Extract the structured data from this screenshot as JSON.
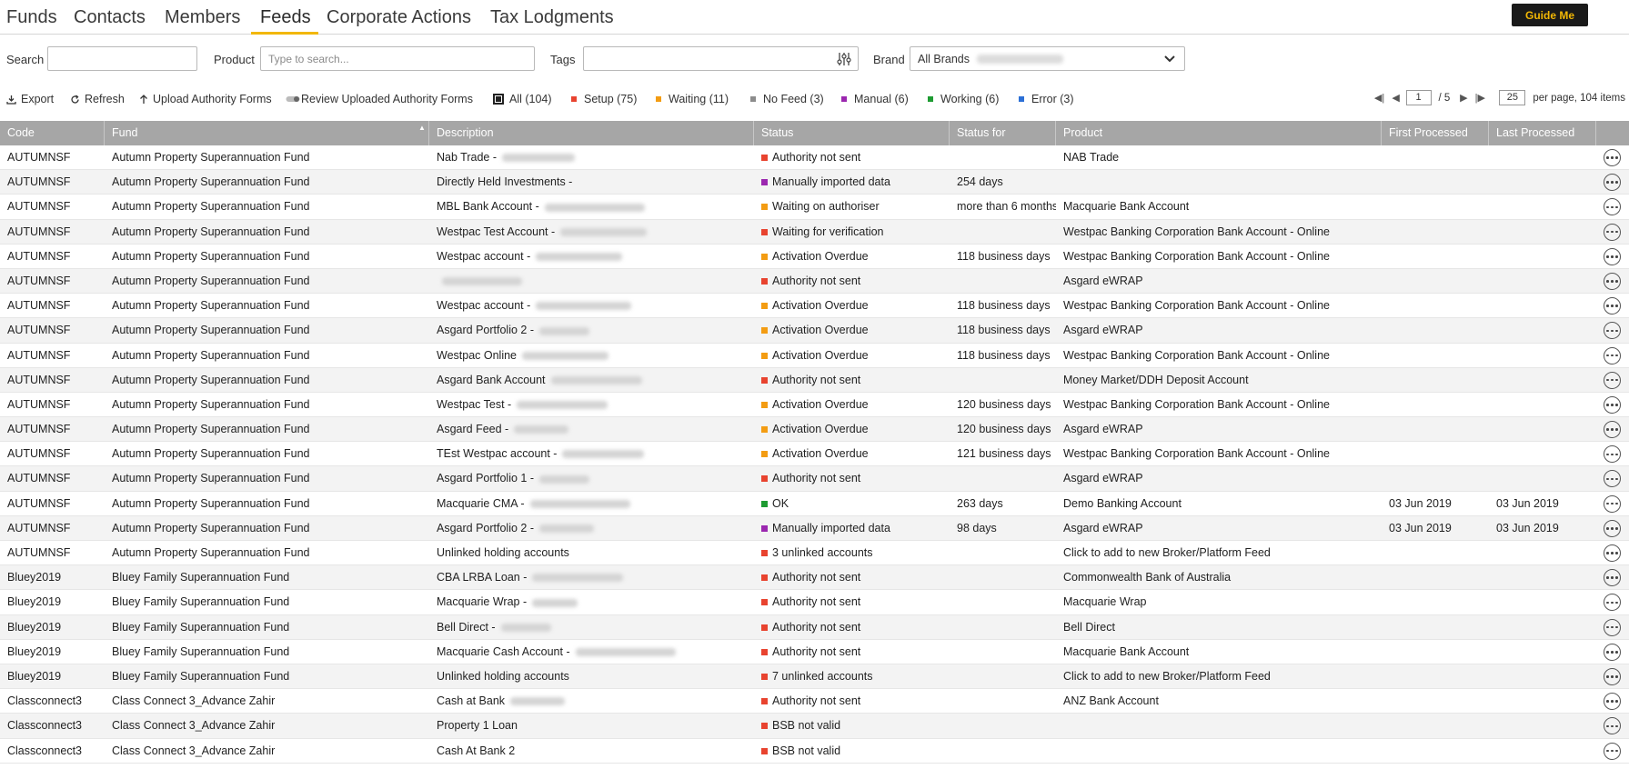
{
  "nav": {
    "tabs": [
      {
        "label": "Funds"
      },
      {
        "label": "Contacts"
      },
      {
        "label": "Members"
      },
      {
        "label": "Feeds"
      },
      {
        "label": "Corporate Actions"
      },
      {
        "label": "Tax Lodgments"
      }
    ],
    "active_tab": "Feeds",
    "guide_button": "Guide Me"
  },
  "filters": {
    "search_label": "Search",
    "search_value": "",
    "product_label": "Product",
    "product_placeholder": "Type to search...",
    "tags_label": "Tags",
    "tags_value": "",
    "brand_label": "Brand",
    "brand_value": "All Brands"
  },
  "toolbar": {
    "export": "Export",
    "refresh": "Refresh",
    "upload": "Upload Authority Forms",
    "review": "Review Uploaded Authority Forms"
  },
  "legend": [
    {
      "label": "All (104)",
      "color": "#222222"
    },
    {
      "label": "Setup (75)",
      "color": "#e8432f"
    },
    {
      "label": "Waiting (11)",
      "color": "#f39c12"
    },
    {
      "label": "No Feed (3)",
      "color": "#8c8c8c"
    },
    {
      "label": "Manual (6)",
      "color": "#9b27af"
    },
    {
      "label": "Working (6)",
      "color": "#1e9b32"
    },
    {
      "label": "Error (3)",
      "color": "#2b6fd6"
    }
  ],
  "pagination": {
    "current_page": "1",
    "total_pages": "/ 5",
    "page_size": "25",
    "summary": "per page, 104 items"
  },
  "columns": [
    "Code",
    "Fund",
    "Description",
    "Status",
    "Status for",
    "Product",
    "First Processed",
    "Last Processed"
  ],
  "status_colors": {
    "red": "#e8432f",
    "orange": "#f39c12",
    "purple": "#9b27af",
    "green": "#1e9b32"
  },
  "rows": [
    {
      "code": "AUTUMNSF",
      "fund": "Autumn Property Superannuation Fund",
      "description": "Nab Trade -",
      "status": "Authority not sent",
      "status_color": "red",
      "status_for": "",
      "product": "NAB Trade",
      "first": "",
      "last": ""
    },
    {
      "code": "AUTUMNSF",
      "fund": "Autumn Property Superannuation Fund",
      "description": "Directly Held Investments -",
      "status": "Manually imported data",
      "status_color": "purple",
      "status_for": "254 days",
      "product": "",
      "first": "",
      "last": ""
    },
    {
      "code": "AUTUMNSF",
      "fund": "Autumn Property Superannuation Fund",
      "description": "MBL Bank Account -",
      "status": "Waiting on authoriser",
      "status_color": "orange",
      "status_for": "more than 6 months",
      "product": "Macquarie Bank Account",
      "first": "",
      "last": ""
    },
    {
      "code": "AUTUMNSF",
      "fund": "Autumn Property Superannuation Fund",
      "description": "Westpac Test Account -",
      "status": "Waiting for verification",
      "status_color": "red",
      "status_for": "",
      "product": "Westpac Banking Corporation Bank Account - Online",
      "first": "",
      "last": ""
    },
    {
      "code": "AUTUMNSF",
      "fund": "Autumn Property Superannuation Fund",
      "description": "Westpac account -",
      "status": "Activation Overdue",
      "status_color": "orange",
      "status_for": "118 business days",
      "product": "Westpac Banking Corporation Bank Account - Online",
      "first": "",
      "last": ""
    },
    {
      "code": "AUTUMNSF",
      "fund": "Autumn Property Superannuation Fund",
      "description": "",
      "status": "Authority not sent",
      "status_color": "red",
      "status_for": "",
      "product": "Asgard eWRAP",
      "first": "",
      "last": ""
    },
    {
      "code": "AUTUMNSF",
      "fund": "Autumn Property Superannuation Fund",
      "description": "Westpac account -",
      "status": "Activation Overdue",
      "status_color": "orange",
      "status_for": "118 business days",
      "product": "Westpac Banking Corporation Bank Account - Online",
      "first": "",
      "last": ""
    },
    {
      "code": "AUTUMNSF",
      "fund": "Autumn Property Superannuation Fund",
      "description": "Asgard Portfolio 2 -",
      "status": "Activation Overdue",
      "status_color": "orange",
      "status_for": "118 business days",
      "product": "Asgard eWRAP",
      "first": "",
      "last": ""
    },
    {
      "code": "AUTUMNSF",
      "fund": "Autumn Property Superannuation Fund",
      "description": "Westpac Online",
      "status": "Activation Overdue",
      "status_color": "orange",
      "status_for": "118 business days",
      "product": "Westpac Banking Corporation Bank Account - Online",
      "first": "",
      "last": ""
    },
    {
      "code": "AUTUMNSF",
      "fund": "Autumn Property Superannuation Fund",
      "description": "Asgard Bank Account",
      "status": "Authority not sent",
      "status_color": "red",
      "status_for": "",
      "product": "Money Market/DDH Deposit Account",
      "first": "",
      "last": ""
    },
    {
      "code": "AUTUMNSF",
      "fund": "Autumn Property Superannuation Fund",
      "description": "Westpac Test -",
      "status": "Activation Overdue",
      "status_color": "orange",
      "status_for": "120 business days",
      "product": "Westpac Banking Corporation Bank Account - Online",
      "first": "",
      "last": ""
    },
    {
      "code": "AUTUMNSF",
      "fund": "Autumn Property Superannuation Fund",
      "description": "Asgard Feed -",
      "status": "Activation Overdue",
      "status_color": "orange",
      "status_for": "120 business days",
      "product": "Asgard eWRAP",
      "first": "",
      "last": ""
    },
    {
      "code": "AUTUMNSF",
      "fund": "Autumn Property Superannuation Fund",
      "description": "TEst Westpac account -",
      "status": "Activation Overdue",
      "status_color": "orange",
      "status_for": "121 business days",
      "product": "Westpac Banking Corporation Bank Account - Online",
      "first": "",
      "last": ""
    },
    {
      "code": "AUTUMNSF",
      "fund": "Autumn Property Superannuation Fund",
      "description": "Asgard Portfolio 1 -",
      "status": "Authority not sent",
      "status_color": "red",
      "status_for": "",
      "product": "Asgard eWRAP",
      "first": "",
      "last": ""
    },
    {
      "code": "AUTUMNSF",
      "fund": "Autumn Property Superannuation Fund",
      "description": "Macquarie CMA -",
      "status": "OK",
      "status_color": "green",
      "status_for": "263 days",
      "product": "Demo Banking Account",
      "first": "03 Jun 2019",
      "last": "03 Jun 2019"
    },
    {
      "code": "AUTUMNSF",
      "fund": "Autumn Property Superannuation Fund",
      "description": "Asgard Portfolio 2 -",
      "status": "Manually imported data",
      "status_color": "purple",
      "status_for": "98 days",
      "product": "Asgard eWRAP",
      "first": "03 Jun 2019",
      "last": "03 Jun 2019"
    },
    {
      "code": "AUTUMNSF",
      "fund": "Autumn Property Superannuation Fund",
      "description": "Unlinked holding accounts",
      "status": "3 unlinked accounts",
      "status_color": "red",
      "status_for": "",
      "product": "Click to add to new Broker/Platform Feed",
      "first": "",
      "last": ""
    },
    {
      "code": "Bluey2019",
      "fund": "Bluey Family Superannuation Fund",
      "description": "CBA LRBA Loan -",
      "status": "Authority not sent",
      "status_color": "red",
      "status_for": "",
      "product": "Commonwealth Bank of Australia",
      "first": "",
      "last": ""
    },
    {
      "code": "Bluey2019",
      "fund": "Bluey Family Superannuation Fund",
      "description": "Macquarie Wrap -",
      "status": "Authority not sent",
      "status_color": "red",
      "status_for": "",
      "product": "Macquarie Wrap",
      "first": "",
      "last": ""
    },
    {
      "code": "Bluey2019",
      "fund": "Bluey Family Superannuation Fund",
      "description": "Bell Direct -",
      "status": "Authority not sent",
      "status_color": "red",
      "status_for": "",
      "product": "Bell Direct",
      "first": "",
      "last": ""
    },
    {
      "code": "Bluey2019",
      "fund": "Bluey Family Superannuation Fund",
      "description": "Macquarie Cash Account -",
      "status": "Authority not sent",
      "status_color": "red",
      "status_for": "",
      "product": "Macquarie Bank Account",
      "first": "",
      "last": ""
    },
    {
      "code": "Bluey2019",
      "fund": "Bluey Family Superannuation Fund",
      "description": "Unlinked holding accounts",
      "status": "7 unlinked accounts",
      "status_color": "red",
      "status_for": "",
      "product": "Click to add to new Broker/Platform Feed",
      "first": "",
      "last": ""
    },
    {
      "code": "Classconnect3",
      "fund": "Class Connect 3_Advance Zahir",
      "description": "Cash at Bank",
      "status": "Authority not sent",
      "status_color": "red",
      "status_for": "",
      "product": "ANZ Bank Account",
      "first": "",
      "last": ""
    },
    {
      "code": "Classconnect3",
      "fund": "Class Connect 3_Advance Zahir",
      "description": "Property 1 Loan",
      "status": "BSB not valid",
      "status_color": "red",
      "status_for": "",
      "product": "",
      "first": "",
      "last": ""
    },
    {
      "code": "Classconnect3",
      "fund": "Class Connect 3_Advance Zahir",
      "description": "Cash At Bank 2",
      "status": "BSB not valid",
      "status_color": "red",
      "status_for": "",
      "product": "",
      "first": "",
      "last": ""
    }
  ]
}
